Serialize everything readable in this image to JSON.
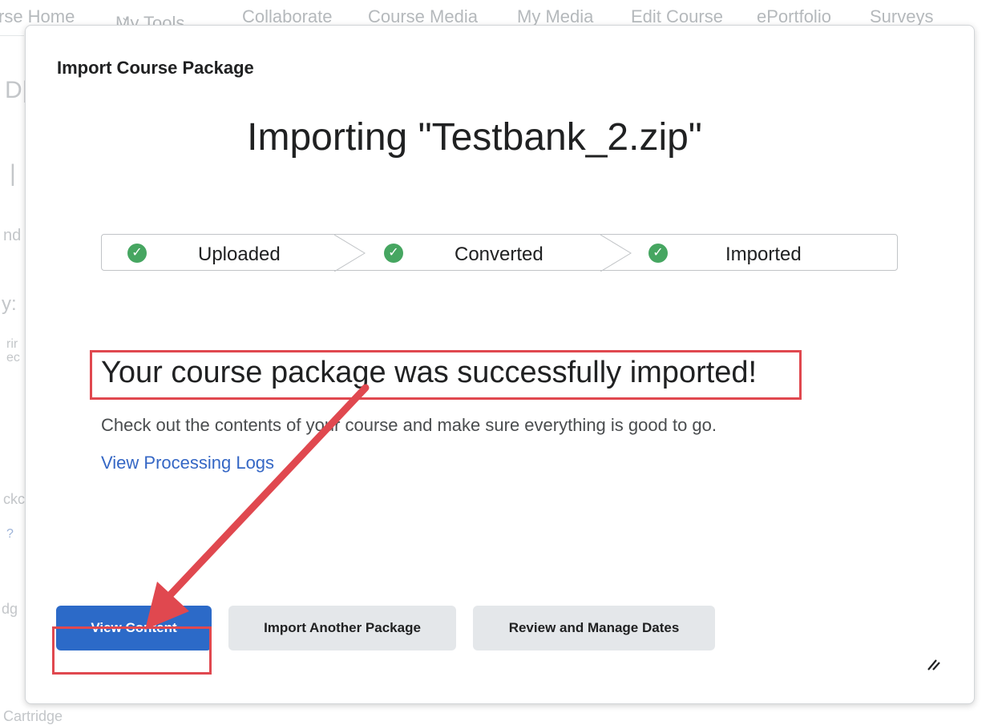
{
  "background_nav": {
    "items": [
      "rse Home",
      "My Tools",
      "Collaborate",
      "Course Media",
      "My Media",
      "Edit Course",
      "ePortfolio",
      "Surveys"
    ]
  },
  "background_fragments": [
    "D|",
    "|",
    "nd",
    "y:",
    "rir",
    "ec",
    "ckc",
    "?",
    "dg",
    "Cartridge"
  ],
  "dialog": {
    "title": "Import Course Package",
    "heading": "Importing \"Testbank_2.zip\"",
    "steps": [
      {
        "label": "Uploaded",
        "status": "complete"
      },
      {
        "label": "Converted",
        "status": "complete"
      },
      {
        "label": "Imported",
        "status": "complete"
      }
    ],
    "success_message": "Your course package was successfully imported!",
    "description": "Check out the contents of your course and make sure everything is good to go.",
    "logs_link": "View Processing Logs",
    "buttons": {
      "view_content": "View Content",
      "import_another": "Import Another Package",
      "review_dates": "Review and Manage Dates"
    }
  },
  "colors": {
    "primary": "#2c6ac8",
    "success": "#46a661",
    "link": "#3567c5",
    "annotation": "#e0484f"
  },
  "icons": [
    "check-icon",
    "chevron-down-icon",
    "resize-handle-icon",
    "annotation-arrow"
  ]
}
